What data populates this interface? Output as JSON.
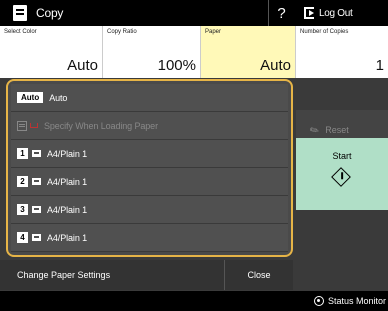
{
  "header": {
    "app_title": "Copy",
    "help_label": "?",
    "logout_label": "Log Out"
  },
  "settings": [
    {
      "label": "Select Color",
      "value": "Auto"
    },
    {
      "label": "Copy Ratio",
      "value": "100%"
    },
    {
      "label": "Paper",
      "value": "Auto"
    },
    {
      "label": "Number of Copies",
      "value": "1"
    }
  ],
  "paper_list": {
    "items": [
      {
        "badge": "Auto",
        "label": "Auto",
        "enabled": true
      },
      {
        "badge": "",
        "label": "Specify When Loading Paper",
        "enabled": false
      },
      {
        "badge": "1",
        "label": "A4/Plain 1",
        "enabled": true
      },
      {
        "badge": "2",
        "label": "A4/Plain 1",
        "enabled": true
      },
      {
        "badge": "3",
        "label": "A4/Plain 1",
        "enabled": true
      },
      {
        "badge": "4",
        "label": "A4/Plain 1",
        "enabled": true
      }
    ]
  },
  "actions": {
    "reset_label": "Reset",
    "start_label": "Start",
    "change_paper_label": "Change Paper Settings",
    "close_label": "Close",
    "status_monitor_label": "Status Monitor"
  },
  "colors": {
    "selected_setting": "#fff9b8",
    "panel_border": "#e6b447",
    "start_button": "#b0dfc7"
  }
}
